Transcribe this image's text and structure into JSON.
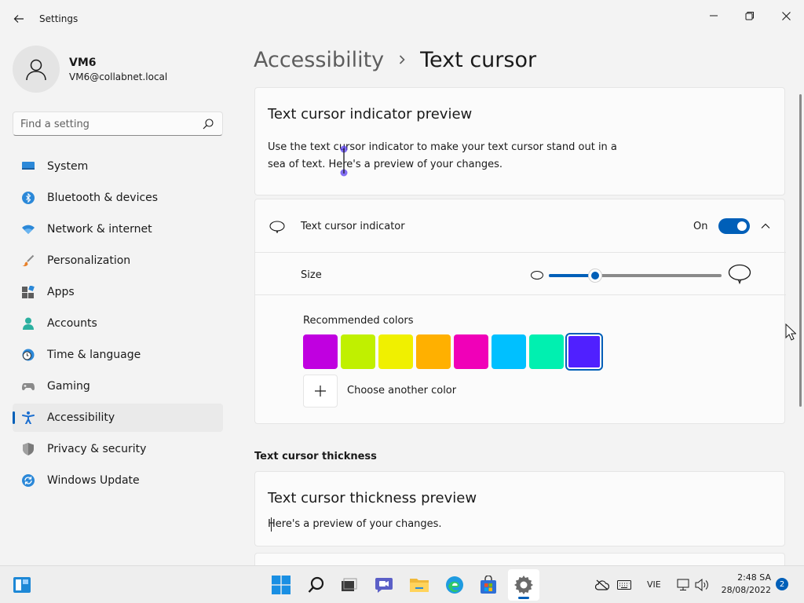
{
  "window": {
    "title": "Settings"
  },
  "profile": {
    "name": "VM6",
    "email": "VM6@collabnet.local"
  },
  "search": {
    "placeholder": "Find a setting"
  },
  "nav": {
    "items": [
      {
        "label": "System",
        "icon": "monitor-icon"
      },
      {
        "label": "Bluetooth & devices",
        "icon": "bluetooth-icon"
      },
      {
        "label": "Network & internet",
        "icon": "wifi-icon"
      },
      {
        "label": "Personalization",
        "icon": "brush-icon"
      },
      {
        "label": "Apps",
        "icon": "apps-icon"
      },
      {
        "label": "Accounts",
        "icon": "person-icon"
      },
      {
        "label": "Time & language",
        "icon": "clock-globe-icon"
      },
      {
        "label": "Gaming",
        "icon": "gamepad-icon"
      },
      {
        "label": "Accessibility",
        "icon": "accessibility-icon",
        "active": true
      },
      {
        "label": "Privacy & security",
        "icon": "shield-icon"
      },
      {
        "label": "Windows Update",
        "icon": "update-icon"
      }
    ]
  },
  "breadcrumb": {
    "parent": "Accessibility",
    "current": "Text cursor"
  },
  "preview_card": {
    "title": "Text cursor indicator preview",
    "description": "Use the text cursor indicator to make your text cursor stand out in a sea of text. Here's a preview of your changes."
  },
  "indicator_card": {
    "label": "Text cursor indicator",
    "state": "On",
    "size_label": "Size",
    "size_level": 0.27,
    "colors_label": "Recommended colors",
    "colors": [
      "#c000e0",
      "#c0f000",
      "#f0f000",
      "#ffb000",
      "#f000b8",
      "#00c0ff",
      "#00f0b0",
      "#5020ff"
    ],
    "selected_color_index": 7,
    "add_color_label": "Choose another color"
  },
  "thickness_section": {
    "heading": "Text cursor thickness"
  },
  "thickness_card": {
    "title": "Text cursor thickness preview",
    "description": "Here's a preview of your changes."
  },
  "taskbar": {
    "language": "VIE",
    "time": "2:48 SA",
    "date": "28/08/2022",
    "notifications": "2"
  },
  "colors": {
    "accent": "#005fb8"
  }
}
